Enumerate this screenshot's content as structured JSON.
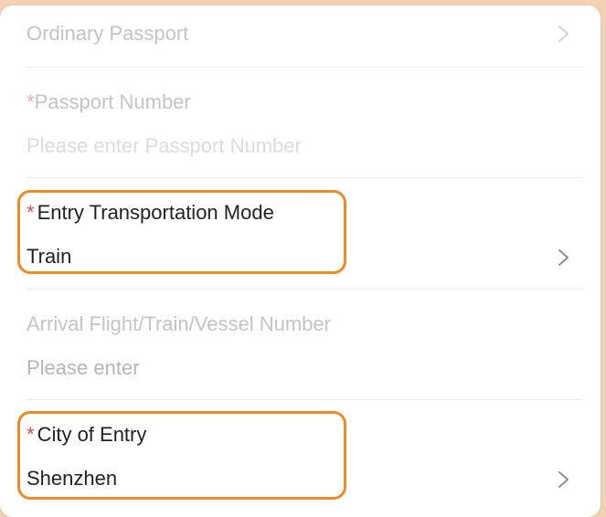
{
  "form": {
    "passport_type": {
      "value": "Ordinary Passport"
    },
    "passport_number": {
      "required_mark": "*",
      "label": "Passport Number",
      "placeholder": "Please enter Passport Number"
    },
    "entry_transport_mode": {
      "required_mark": "*",
      "label": "Entry Transportation Mode",
      "value": "Train"
    },
    "arrival_number": {
      "label": "Arrival Flight/Train/Vessel Number",
      "placeholder": "Please enter"
    },
    "city_of_entry": {
      "required_mark": "*",
      "label": "City of Entry",
      "value": "Shenzhen"
    }
  },
  "colors": {
    "background": "#f3d2b3",
    "card": "#ffffff",
    "highlight": "#f08a24",
    "required": "#e5484d"
  },
  "icons": {
    "chevron": "chevron-right-icon"
  }
}
